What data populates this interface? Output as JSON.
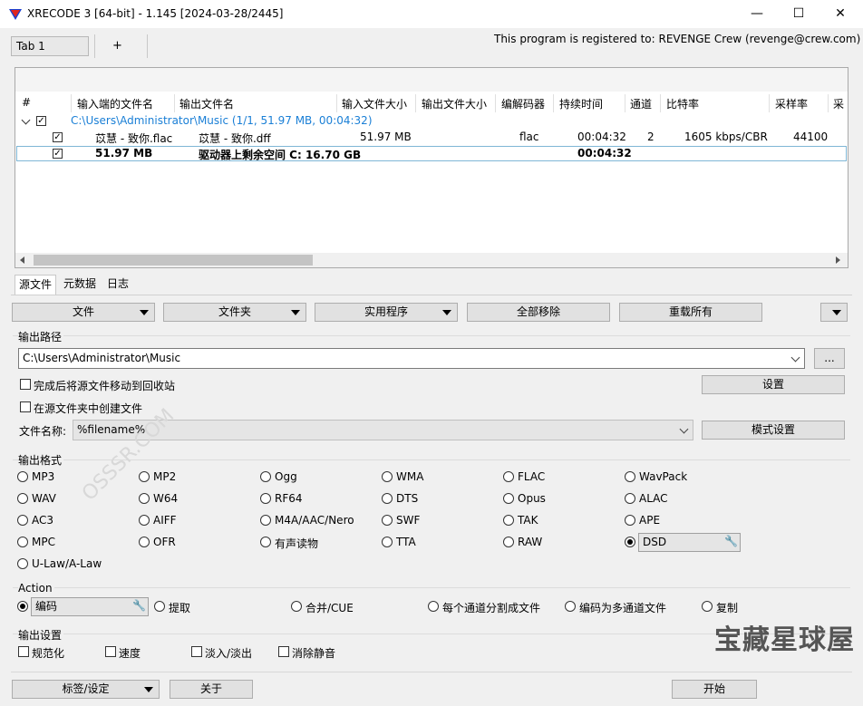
{
  "window": {
    "title": "XRECODE 3 [64-bit] - 1.145 [2024-03-28/2445]",
    "minimize": "—",
    "maximize": "☐",
    "close": "✕"
  },
  "tabs": {
    "tab1": "Tab 1",
    "add": "+"
  },
  "registration": "This program is registered to: REVENGE Crew (revenge@crew.com)",
  "file_list": {
    "columns": [
      "#",
      "输入端的文件名",
      "输出文件名",
      "输入文件大小",
      "输出文件大小",
      "编解码器",
      "持续时间",
      "通道",
      "比特率",
      "采样率",
      "采"
    ],
    "group_path": "C:\\Users\\Administrator\\Music (1/1, 51.97 MB, 00:04:32)",
    "rows": [
      {
        "input_name": "苡慧 - 致你.flac",
        "output_name": "苡慧 - 致你.dff",
        "input_size": "51.97 MB",
        "output_size": "",
        "codec": "flac",
        "duration": "00:04:32",
        "channels": "2",
        "bitrate": "1605 kbps/CBR",
        "samplerate": "44100"
      }
    ],
    "total": {
      "size": "51.97 MB",
      "free_space": "驱动器上剩余空间 C: 16.70 GB",
      "duration": "00:04:32"
    }
  },
  "source_tabs": [
    "源文件",
    "元数据",
    "日志"
  ],
  "toolbar": {
    "files": "文件",
    "folder": "文件夹",
    "utilities": "实用程序",
    "remove_all": "全部移除",
    "reload_all": "重载所有"
  },
  "output_path": {
    "label": "输出路径",
    "value": "C:\\Users\\Administrator\\Music",
    "browse": "...",
    "move_to_recycle": "完成后将源文件移动到回收站",
    "settings": "设置",
    "create_in_source": "在源文件夹中创建文件",
    "filename_label": "文件名称:",
    "filename_value": "%filename%",
    "pattern_settings": "模式设置"
  },
  "output_format": {
    "label": "输出格式",
    "options": [
      [
        "MP3",
        "MP2",
        "Ogg",
        "WMA",
        "FLAC",
        "WavPack"
      ],
      [
        "WAV",
        "W64",
        "RF64",
        "DTS",
        "Opus",
        "ALAC"
      ],
      [
        "AC3",
        "AIFF",
        "M4A/AAC/Nero",
        "SWF",
        "TAK",
        "APE"
      ],
      [
        "MPC",
        "OFR",
        "有声读物",
        "TTA",
        "RAW",
        "DSD"
      ],
      [
        "U-Law/A-Law"
      ]
    ],
    "selected": "DSD"
  },
  "action": {
    "label": "Action",
    "options": [
      "编码",
      "提取",
      "合并/CUE",
      "每个通道分割成文件",
      "编码为多通道文件",
      "复制"
    ],
    "selected": "编码"
  },
  "output_settings": {
    "label": "输出设置",
    "options": [
      "规范化",
      "速度",
      "淡入/淡出",
      "消除静音"
    ]
  },
  "bottom": {
    "tags_settings": "标签/设定",
    "about": "关于",
    "start": "开始"
  },
  "overlay": {
    "brand_watermark": "宝藏星球屋",
    "site_watermark": "OSSSR.COM"
  }
}
